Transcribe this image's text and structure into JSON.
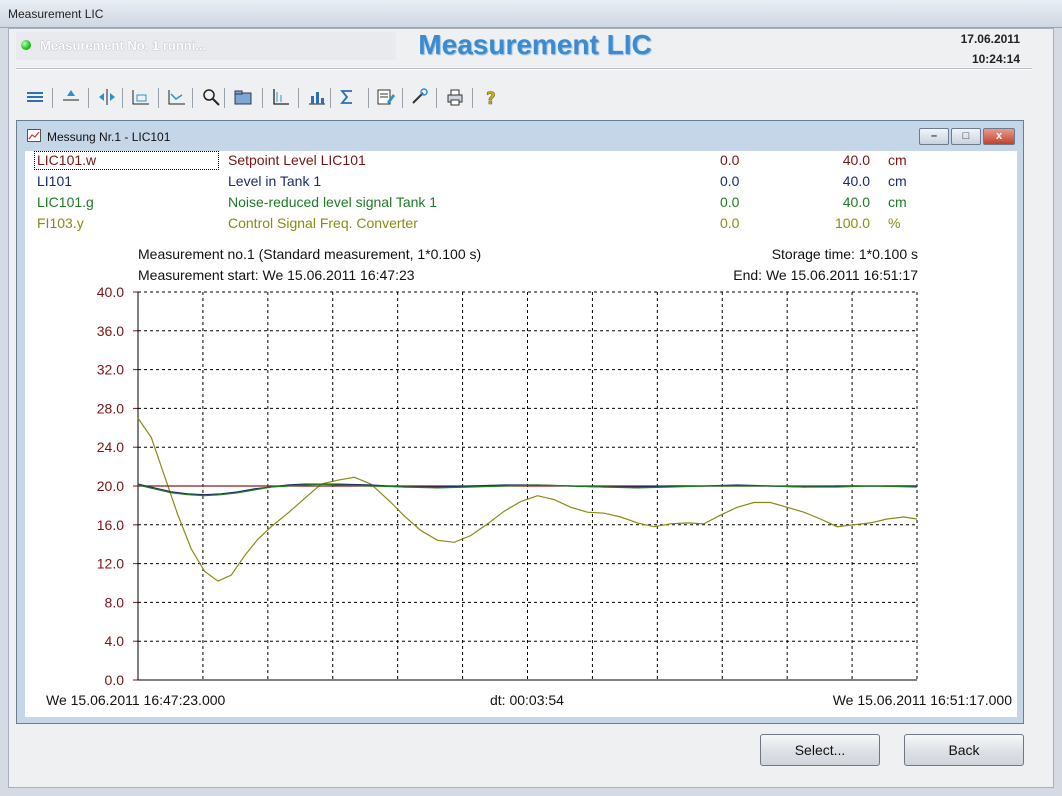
{
  "window": {
    "title": "Measurement LIC"
  },
  "header": {
    "status": "Measurement No. 1 runni...",
    "app_title": "Measurement LIC",
    "date": "17.06.2011",
    "time": "10:24:14"
  },
  "toolbar": {
    "icons": [
      "list-icon",
      "move-up-icon",
      "move-horizontal-icon",
      "zoom-axis-icon",
      "zoom-area-icon",
      "search-icon",
      "folder-icon",
      "axis-icon",
      "bar-chart-icon",
      "sigma-icon",
      "notes-icon",
      "tools-icon",
      "print-icon",
      "help-icon"
    ]
  },
  "child_window": {
    "title": "Messung Nr.1 - LIC101",
    "min": "–",
    "max": "□",
    "close": "x"
  },
  "legend": [
    {
      "tag": "LIC101.w",
      "desc": "Setpoint Level LIC101",
      "min": "0.0",
      "max": "40.0",
      "unit": "cm",
      "color": "#7a1414"
    },
    {
      "tag": "LI101",
      "desc": "Level in Tank 1",
      "min": "0.0",
      "max": "40.0",
      "unit": "cm",
      "color": "#1a2a6c"
    },
    {
      "tag": "LIC101.g",
      "desc": "Noise-reduced level signal Tank 1",
      "min": "0.0",
      "max": "40.0",
      "unit": "cm",
      "color": "#1f7a23"
    },
    {
      "tag": "FI103.y",
      "desc": "Control Signal Freq. Converter",
      "min": "0.0",
      "max": "100.0",
      "unit": "%",
      "color": "#8a8a12"
    }
  ],
  "info": {
    "measurement": "Measurement no.1 (Standard measurement, 1*0.100 s)",
    "start": "Measurement start: We 15.06.2011 16:47:23",
    "storage": "Storage time: 1*0.100 s",
    "end": "End: We 15.06.2011 16:51:17"
  },
  "footer": {
    "start_time": "We 15.06.2011 16:47:23.000",
    "dt": "dt: 00:03:54",
    "end_time": "We 15.06.2011 16:51:17.000"
  },
  "buttons": {
    "select": "Select...",
    "back": "Back"
  },
  "chart_data": {
    "type": "line",
    "title": "",
    "xlabel": "",
    "ylabel": "",
    "xlim": [
      0,
      234
    ],
    "ylim": [
      0,
      40
    ],
    "yticks": [
      "0.0",
      "4.0",
      "8.0",
      "12.0",
      "16.0",
      "20.0",
      "24.0",
      "28.0",
      "32.0",
      "36.0",
      "40.0"
    ],
    "grid": true,
    "axis_color": "#7a1414",
    "series": [
      {
        "name": "LIC101.w",
        "color": "#8b1a1a",
        "x": [
          0,
          234
        ],
        "y": [
          20,
          20
        ]
      },
      {
        "name": "LI101",
        "color": "#1a2a6c",
        "x": [
          0,
          5,
          10,
          15,
          20,
          25,
          30,
          35,
          40,
          45,
          50,
          55,
          60,
          70,
          80,
          90,
          100,
          110,
          120,
          130,
          140,
          150,
          160,
          170,
          180,
          190,
          200,
          210,
          220,
          234
        ],
        "y": [
          20.2,
          19.8,
          19.4,
          19.2,
          19.1,
          19.2,
          19.4,
          19.7,
          19.9,
          20.1,
          20.2,
          20.2,
          20.2,
          20.1,
          19.9,
          19.9,
          20.0,
          20.1,
          20.1,
          20.0,
          19.9,
          19.9,
          20.0,
          20.0,
          20.1,
          20.0,
          19.9,
          20.0,
          20.0,
          20.0
        ]
      },
      {
        "name": "LIC101.g",
        "color": "#1f7a23",
        "x": [
          0,
          5,
          10,
          15,
          20,
          25,
          30,
          35,
          40,
          45,
          50,
          55,
          60,
          70,
          80,
          90,
          100,
          110,
          120,
          130,
          140,
          150,
          160,
          170,
          180,
          190,
          200,
          210,
          220,
          234
        ],
        "y": [
          20.1,
          19.7,
          19.3,
          19.1,
          19.0,
          19.1,
          19.3,
          19.6,
          19.9,
          20.0,
          20.1,
          20.2,
          20.1,
          20.0,
          19.9,
          19.8,
          19.9,
          20.0,
          20.1,
          20.0,
          19.9,
          19.8,
          19.9,
          20.0,
          20.0,
          20.0,
          19.9,
          19.9,
          20.0,
          19.9
        ]
      },
      {
        "name": "FI103.y",
        "color": "#8a8a12",
        "x": [
          0,
          4,
          8,
          12,
          16,
          20,
          24,
          28,
          32,
          36,
          40,
          45,
          50,
          55,
          60,
          65,
          70,
          76,
          80,
          85,
          90,
          95,
          100,
          105,
          110,
          115,
          120,
          125,
          130,
          135,
          140,
          145,
          150,
          155,
          160,
          165,
          170,
          175,
          180,
          185,
          190,
          195,
          200,
          205,
          210,
          215,
          220,
          225,
          230,
          234
        ],
        "y": [
          27.0,
          25.0,
          21.0,
          17.0,
          13.5,
          11.2,
          10.2,
          10.8,
          12.8,
          14.5,
          15.8,
          17.2,
          18.7,
          20.2,
          20.6,
          20.9,
          20.2,
          18.3,
          16.9,
          15.4,
          14.4,
          14.2,
          14.9,
          16.1,
          17.4,
          18.4,
          19.0,
          18.6,
          17.8,
          17.3,
          17.2,
          16.8,
          16.2,
          15.8,
          16.1,
          16.2,
          16.1,
          17.0,
          17.8,
          18.3,
          18.3,
          17.8,
          17.3,
          16.6,
          15.8,
          16.0,
          16.2,
          16.6,
          16.8,
          16.6
        ]
      }
    ]
  }
}
